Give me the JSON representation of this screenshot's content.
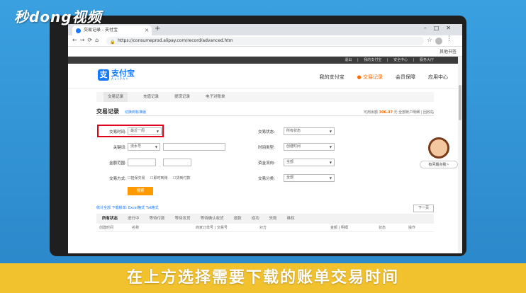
{
  "watermark": "秒dong视频",
  "browser": {
    "tab_title": "交易记录 - 支付宝",
    "url": "https://consumeprod.alipay.com/record/advanced.htm",
    "bookmark_folder": "其他书签"
  },
  "site": {
    "top_links": "退出  |  我的支付宝  |  安全中心  |  服务大厅",
    "logo_name": "支付宝",
    "logo_sub": "ALIPAY",
    "nav": [
      "我的支付宝",
      "交易记录",
      "会员保障",
      "应用中心"
    ],
    "subtabs": [
      "交易记录",
      "充值记录",
      "提现记录",
      "电子对账单"
    ]
  },
  "record": {
    "title": "交易记录",
    "switch_link": "切换到标准版",
    "balance_label": "可用余额",
    "balance_value": "306.47",
    "balance_suffix": "元 全部账户明细 | 回收站"
  },
  "form": {
    "time_label": "交易时间:",
    "time_value": "最近一周",
    "keyword_label": "关键词:",
    "keyword_value": "流水号",
    "amount_label": "金额范围:",
    "method_label": "交易方式:",
    "method_options": [
      "担保交易",
      "即时到账",
      "货到付款"
    ],
    "status_label": "交易状态:",
    "status_value": "所有状态",
    "timetype_label": "时间类型:",
    "timetype_value": "创建时间",
    "flow_label": "资金流向:",
    "flow_value": "全部",
    "category_label": "交易分类:",
    "category_value": "全部",
    "search_button": "搜索"
  },
  "export": {
    "text": "统计全部  下载账单: Excel格式  Txt格式",
    "next_page": "下一页"
  },
  "status_tabs": [
    "所有状态",
    "进行中",
    "等待付款",
    "等待发货",
    "等待确认收货",
    "退款",
    "成功",
    "失败",
    "维权"
  ],
  "columns": [
    "创建时间",
    "名称",
    "商家订单号 | 交易号",
    "对方",
    "金额 | 明细",
    "状态",
    "操作"
  ],
  "helper_caption": "有问题点我~",
  "caption": "在上方选择需要下载的账单交易时间"
}
